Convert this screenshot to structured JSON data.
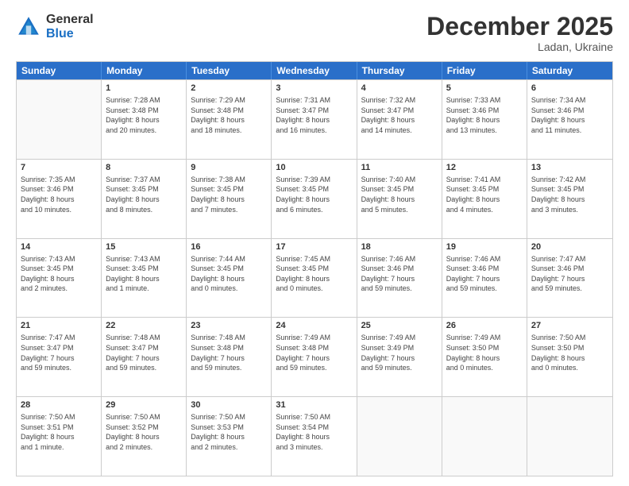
{
  "header": {
    "logo_general": "General",
    "logo_blue": "Blue",
    "month_title": "December 2025",
    "location": "Ladan, Ukraine"
  },
  "days_of_week": [
    "Sunday",
    "Monday",
    "Tuesday",
    "Wednesday",
    "Thursday",
    "Friday",
    "Saturday"
  ],
  "weeks": [
    [
      {
        "day": "",
        "info": ""
      },
      {
        "day": "1",
        "info": "Sunrise: 7:28 AM\nSunset: 3:48 PM\nDaylight: 8 hours\nand 20 minutes."
      },
      {
        "day": "2",
        "info": "Sunrise: 7:29 AM\nSunset: 3:48 PM\nDaylight: 8 hours\nand 18 minutes."
      },
      {
        "day": "3",
        "info": "Sunrise: 7:31 AM\nSunset: 3:47 PM\nDaylight: 8 hours\nand 16 minutes."
      },
      {
        "day": "4",
        "info": "Sunrise: 7:32 AM\nSunset: 3:47 PM\nDaylight: 8 hours\nand 14 minutes."
      },
      {
        "day": "5",
        "info": "Sunrise: 7:33 AM\nSunset: 3:46 PM\nDaylight: 8 hours\nand 13 minutes."
      },
      {
        "day": "6",
        "info": "Sunrise: 7:34 AM\nSunset: 3:46 PM\nDaylight: 8 hours\nand 11 minutes."
      }
    ],
    [
      {
        "day": "7",
        "info": "Sunrise: 7:35 AM\nSunset: 3:46 PM\nDaylight: 8 hours\nand 10 minutes."
      },
      {
        "day": "8",
        "info": "Sunrise: 7:37 AM\nSunset: 3:45 PM\nDaylight: 8 hours\nand 8 minutes."
      },
      {
        "day": "9",
        "info": "Sunrise: 7:38 AM\nSunset: 3:45 PM\nDaylight: 8 hours\nand 7 minutes."
      },
      {
        "day": "10",
        "info": "Sunrise: 7:39 AM\nSunset: 3:45 PM\nDaylight: 8 hours\nand 6 minutes."
      },
      {
        "day": "11",
        "info": "Sunrise: 7:40 AM\nSunset: 3:45 PM\nDaylight: 8 hours\nand 5 minutes."
      },
      {
        "day": "12",
        "info": "Sunrise: 7:41 AM\nSunset: 3:45 PM\nDaylight: 8 hours\nand 4 minutes."
      },
      {
        "day": "13",
        "info": "Sunrise: 7:42 AM\nSunset: 3:45 PM\nDaylight: 8 hours\nand 3 minutes."
      }
    ],
    [
      {
        "day": "14",
        "info": "Sunrise: 7:43 AM\nSunset: 3:45 PM\nDaylight: 8 hours\nand 2 minutes."
      },
      {
        "day": "15",
        "info": "Sunrise: 7:43 AM\nSunset: 3:45 PM\nDaylight: 8 hours\nand 1 minute."
      },
      {
        "day": "16",
        "info": "Sunrise: 7:44 AM\nSunset: 3:45 PM\nDaylight: 8 hours\nand 0 minutes."
      },
      {
        "day": "17",
        "info": "Sunrise: 7:45 AM\nSunset: 3:45 PM\nDaylight: 8 hours\nand 0 minutes."
      },
      {
        "day": "18",
        "info": "Sunrise: 7:46 AM\nSunset: 3:46 PM\nDaylight: 7 hours\nand 59 minutes."
      },
      {
        "day": "19",
        "info": "Sunrise: 7:46 AM\nSunset: 3:46 PM\nDaylight: 7 hours\nand 59 minutes."
      },
      {
        "day": "20",
        "info": "Sunrise: 7:47 AM\nSunset: 3:46 PM\nDaylight: 7 hours\nand 59 minutes."
      }
    ],
    [
      {
        "day": "21",
        "info": "Sunrise: 7:47 AM\nSunset: 3:47 PM\nDaylight: 7 hours\nand 59 minutes."
      },
      {
        "day": "22",
        "info": "Sunrise: 7:48 AM\nSunset: 3:47 PM\nDaylight: 7 hours\nand 59 minutes."
      },
      {
        "day": "23",
        "info": "Sunrise: 7:48 AM\nSunset: 3:48 PM\nDaylight: 7 hours\nand 59 minutes."
      },
      {
        "day": "24",
        "info": "Sunrise: 7:49 AM\nSunset: 3:48 PM\nDaylight: 7 hours\nand 59 minutes."
      },
      {
        "day": "25",
        "info": "Sunrise: 7:49 AM\nSunset: 3:49 PM\nDaylight: 7 hours\nand 59 minutes."
      },
      {
        "day": "26",
        "info": "Sunrise: 7:49 AM\nSunset: 3:50 PM\nDaylight: 8 hours\nand 0 minutes."
      },
      {
        "day": "27",
        "info": "Sunrise: 7:50 AM\nSunset: 3:50 PM\nDaylight: 8 hours\nand 0 minutes."
      }
    ],
    [
      {
        "day": "28",
        "info": "Sunrise: 7:50 AM\nSunset: 3:51 PM\nDaylight: 8 hours\nand 1 minute."
      },
      {
        "day": "29",
        "info": "Sunrise: 7:50 AM\nSunset: 3:52 PM\nDaylight: 8 hours\nand 2 minutes."
      },
      {
        "day": "30",
        "info": "Sunrise: 7:50 AM\nSunset: 3:53 PM\nDaylight: 8 hours\nand 2 minutes."
      },
      {
        "day": "31",
        "info": "Sunrise: 7:50 AM\nSunset: 3:54 PM\nDaylight: 8 hours\nand 3 minutes."
      },
      {
        "day": "",
        "info": ""
      },
      {
        "day": "",
        "info": ""
      },
      {
        "day": "",
        "info": ""
      }
    ]
  ]
}
